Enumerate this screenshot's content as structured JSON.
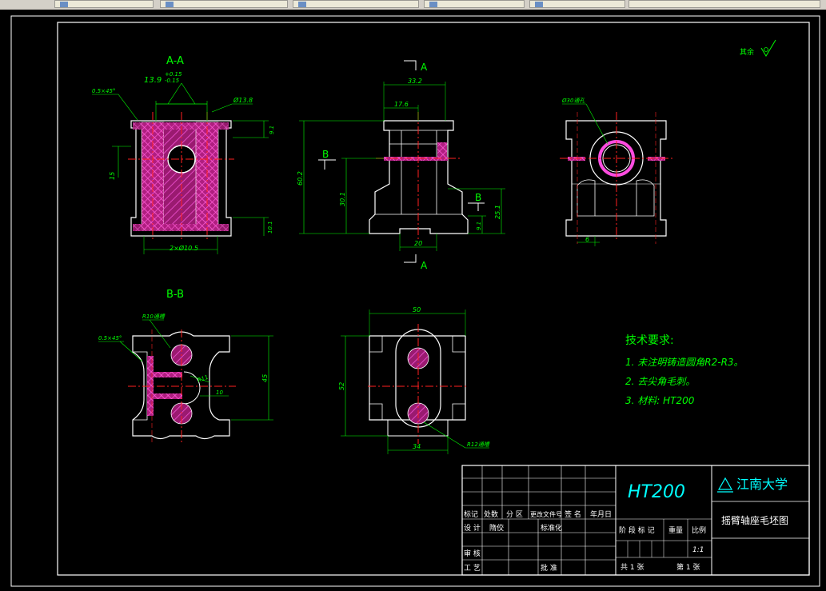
{
  "tabs": [
    "",
    "",
    "",
    "",
    "",
    ""
  ],
  "views": {
    "section_aa": "A-A",
    "section_bb": "B-B",
    "cut_a_top": "A",
    "cut_a_bottom": "A",
    "cut_b_left": "B",
    "cut_b_right": "B"
  },
  "dims": {
    "chamfer_top": "0.5×45°",
    "bore_tol": "13.9",
    "tol_upper": "+0.15",
    "tol_lower": "-0.15",
    "dia_138": "Ø13.8",
    "d15": "15",
    "d91a": "9.1",
    "d101": "10.1",
    "d2x105": "2×Ø10.5",
    "d332": "33.2",
    "d176": "17.6",
    "d602": "60.2",
    "d301": "30.1",
    "d251": "25.1",
    "d91b": "9.1",
    "d20": "20",
    "d30hole": "Ø30通孔",
    "d6": "6",
    "r10": "R10通槽",
    "chamfer_bb": "0.5×45°",
    "r11": "R11",
    "d10": "10",
    "d45": "45",
    "d50": "50",
    "d52": "52",
    "d34": "34",
    "r12": "R12通槽"
  },
  "roughness": "其余",
  "tech": {
    "title": "技术要求:",
    "items": [
      "1. 未注明铸造圆角R2-R3。",
      "2. 去尖角毛刺。",
      "3. 材料: HT200"
    ]
  },
  "titleblock": {
    "material": "HT200",
    "school": "江南大学",
    "part_name": "摇臂轴座毛坯图",
    "h_marks": "标记",
    "h_count": "处数",
    "h_zone": "分 区",
    "h_doc": "更改文件号",
    "h_sign": "签 名",
    "h_date": "年月日",
    "r_design": "设 计",
    "r_check": "审 核",
    "r_process": "工 艺",
    "r_norm": "标准化",
    "r_approve": "批 准",
    "r_shen": "隋佼",
    "stage": "阶 段 标 记",
    "weight": "重量",
    "scale_h": "比例",
    "scale": "1:1",
    "sheets": "共 1 张",
    "sheet_no": "第 1 张"
  }
}
